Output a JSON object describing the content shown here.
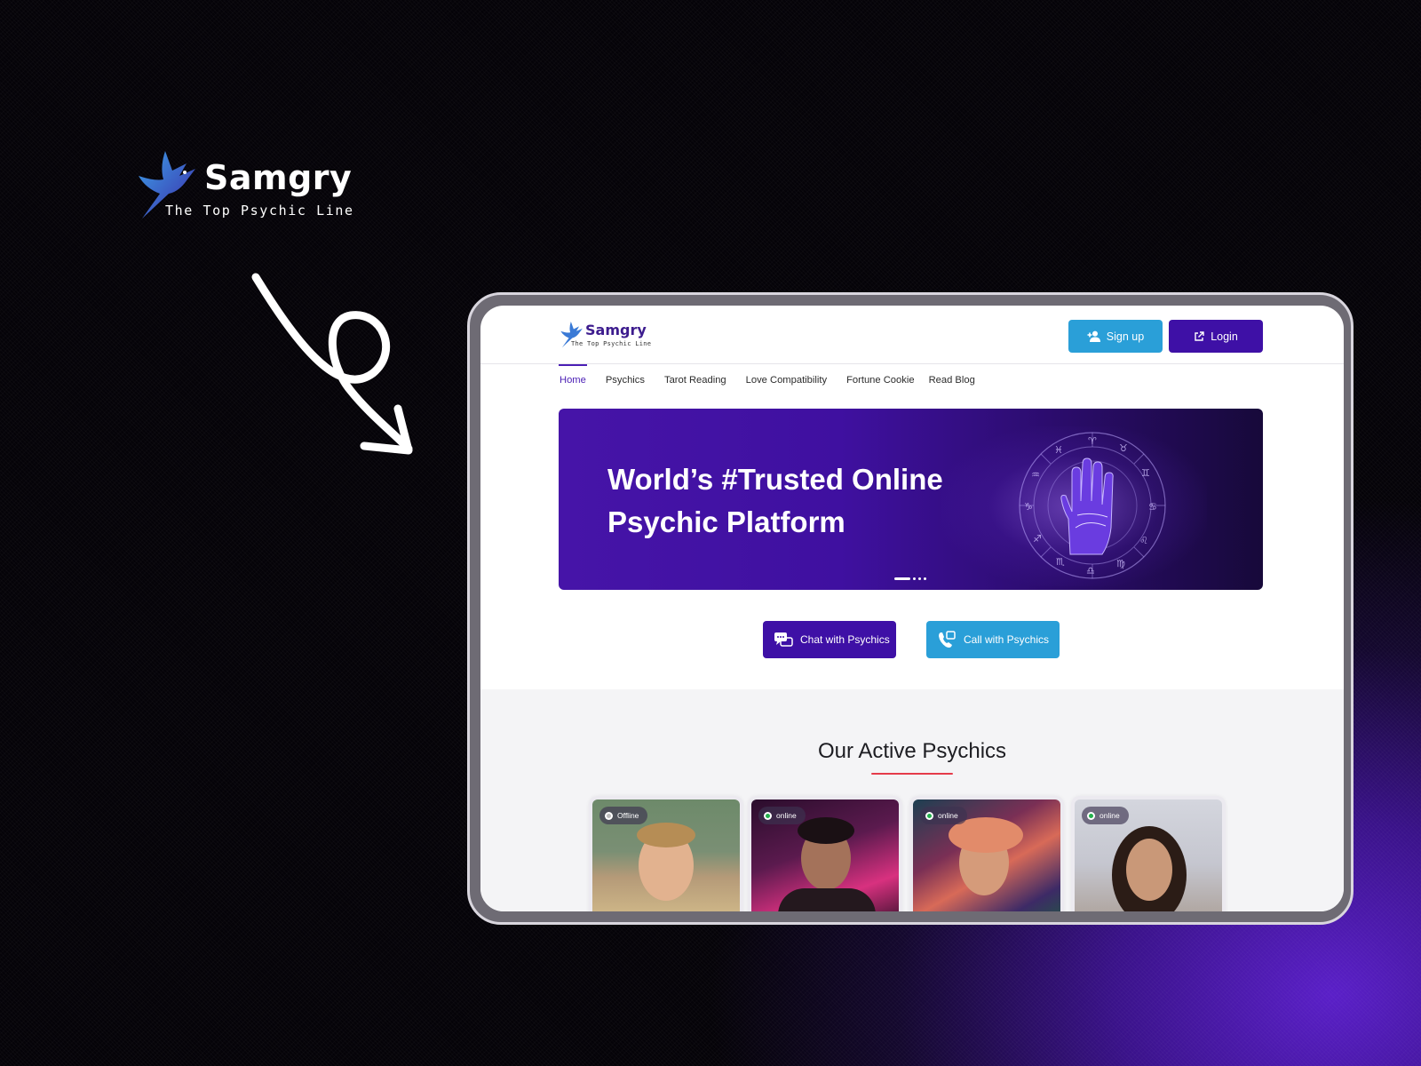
{
  "brand": {
    "name": "Samgry",
    "tagline": "The Top Psychic Line",
    "logo_icon": "hummingbird-icon",
    "colors": {
      "primary": "#3e10a6",
      "secondary": "#2a9fd8",
      "accent": "#e53b4a"
    }
  },
  "site": {
    "header": {
      "logo_name": "Samgry",
      "logo_tagline": "The Top Psychic Line",
      "signup_label": "Sign up",
      "login_label": "Login"
    },
    "nav": {
      "items": [
        {
          "label": "Home",
          "active": true
        },
        {
          "label": "Psychics"
        },
        {
          "label": "Tarot Reading"
        },
        {
          "label": "Love Compatibility"
        },
        {
          "label": "Fortune Cookie"
        },
        {
          "label": "Read Blog"
        }
      ]
    },
    "banner": {
      "line1": "World’s #Trusted Online",
      "line2": "Psychic Platform",
      "slides_total": 4,
      "active_slide": 1
    },
    "cta": {
      "chat_label": "Chat with Psychics",
      "call_label": "Call with Psychics"
    },
    "psychics": {
      "title": "Our Active Psychics",
      "cards": [
        {
          "status": "Offline",
          "status_color": "#bdbdbd"
        },
        {
          "status": "online",
          "status_color": "#22b04b"
        },
        {
          "status": "online",
          "status_color": "#22b04b"
        },
        {
          "status": "online",
          "status_color": "#22b04b"
        }
      ]
    }
  }
}
